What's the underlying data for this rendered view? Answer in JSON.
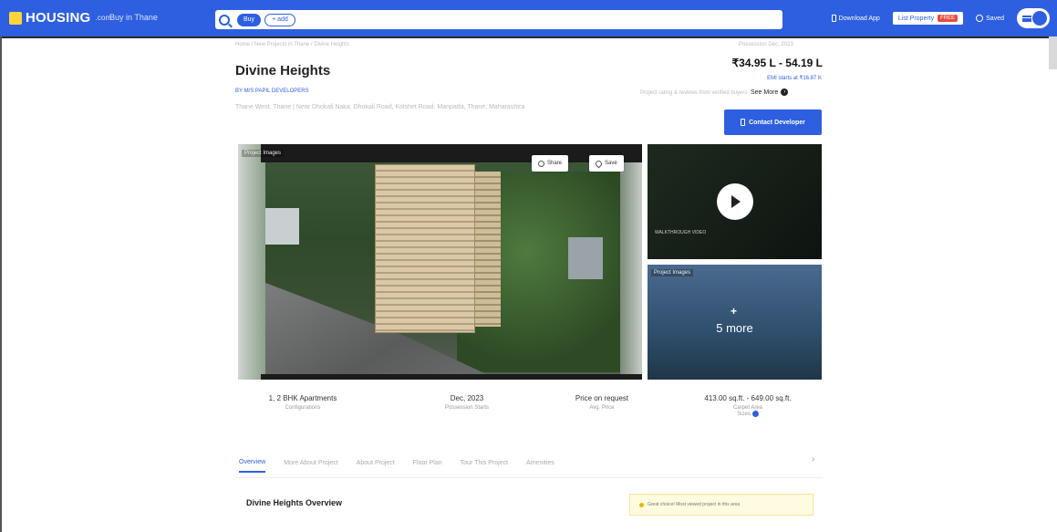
{
  "nav": {
    "logo_text": "HOUSING",
    "logo_tld": ".com",
    "city": "Buy in Thane",
    "chips": [
      "Buy",
      "+ add"
    ],
    "download_app": "Download App",
    "list_property": "List Property",
    "free_badge": "FREE",
    "saved": "Saved"
  },
  "project": {
    "breadcrumb": "Home / New Projects in Thane / Divine Heights",
    "possession_top": "Possession Dec, 2023",
    "title": "Divine Heights",
    "price_range": "₹34.95 L - 54.19 L",
    "emi": "EMI starts at ₹16.87 K",
    "developer": "BY M/S PAPIL DEVELOPERS",
    "address": "Thane West, Thane | Near Dhokali Naka, Dhokali Road, Kolshet Road, Manpada, Thane, Maharashtra",
    "reviews_note": "Project rating & reviews from verified buyers",
    "see_more": "See More",
    "contact_button": "Contact Developer"
  },
  "gallery": {
    "main_label": "Project Images",
    "share": "Share",
    "save": "Save",
    "video_label": "WALKTHROUGH VIDEO",
    "more_label": "Project Images",
    "more_plus": "+",
    "more_text": "5 more"
  },
  "stats": [
    {
      "value": "1, 2 BHK Apartments",
      "label": "Configurations"
    },
    {
      "value": "Dec, 2023",
      "label": "Possession Starts"
    },
    {
      "value": "Price on request",
      "label": "Avg. Price"
    },
    {
      "value": "413.00 sq.ft. - 649.00 sq.ft.",
      "label": "Carpet Area",
      "label2": "Sizes"
    }
  ],
  "tabs": [
    "Overview",
    "More About Project",
    "About Project",
    "Floor Plan",
    "Tour This Project",
    "Amenities"
  ],
  "tab_chevron": "›",
  "overview_title": "Divine Heights Overview",
  "highlight_text": "Great choice! Most viewed project in this area"
}
